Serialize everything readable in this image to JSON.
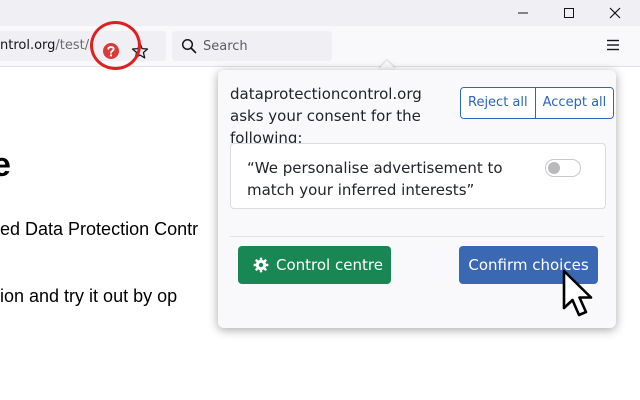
{
  "browser": {
    "url_domain": "ntrol.org",
    "url_path": "/test/",
    "search_placeholder": "Search"
  },
  "icons": {
    "extension": "question-badge-icon",
    "bookmark": "star-icon",
    "search": "magnifier-icon",
    "menu": "hamburger-menu-icon",
    "window_minimize": "minimize-icon",
    "window_maximize": "maximize-icon",
    "window_close": "close-icon",
    "control_centre": "gear-icon",
    "pointer": "mouse-pointer-icon"
  },
  "page": {
    "heading": "e",
    "line1": "ed Data Protection Contr",
    "line2": "ion and try it out by op"
  },
  "popup": {
    "intro": "dataprotectioncontrol.org asks your consent for the following:",
    "reject_all": "Reject all",
    "accept_all": "Accept all",
    "purpose_text": "“We personalise advertisement to match your inferred interests”",
    "purpose_enabled": false,
    "control_centre": "Control centre",
    "confirm_choices": "Confirm choices"
  },
  "colors": {
    "annotation_circle": "#e02020",
    "reject_accept_accent": "#2b63c6",
    "control_centre_bg": "#198754",
    "confirm_bg": "#3b68b3",
    "extension_badge": "#d93a3a"
  }
}
